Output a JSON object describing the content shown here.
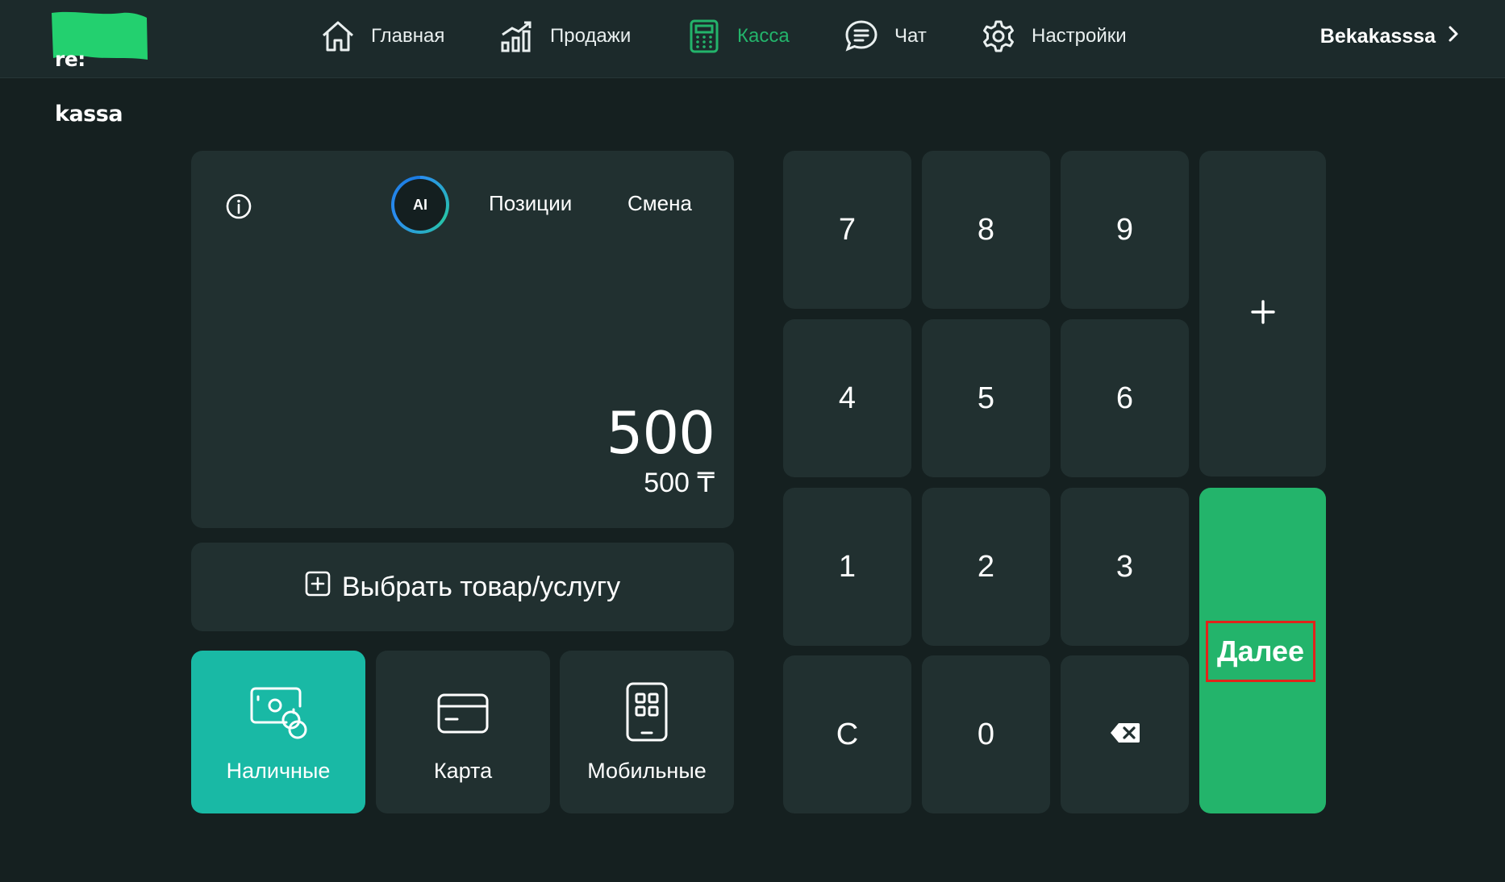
{
  "colors": {
    "background": "#152020",
    "topbar": "#1c2a2b",
    "panel": "#213030",
    "accent_green": "#23b46b",
    "active_payment": "#19b9a5",
    "highlight_border": "#e2231a"
  },
  "logo": {
    "line1": "re:",
    "line2": "kassa"
  },
  "nav": [
    {
      "label": "Главная",
      "icon": "home-icon"
    },
    {
      "label": "Продажи",
      "icon": "bar-chart-icon"
    },
    {
      "label": "Касса",
      "icon": "calculator-icon",
      "active": true
    },
    {
      "label": "Чат",
      "icon": "chat-icon"
    },
    {
      "label": "Настройки",
      "icon": "gear-icon"
    }
  ],
  "user": {
    "name": "Bekakasssa",
    "icon": "chevron-right-icon"
  },
  "panel": {
    "ai_label": "AI",
    "positions_label": "Позиции",
    "shift_label": "Смена",
    "amount_expression": "500",
    "amount_total": "500 ₸"
  },
  "choose_product": {
    "label": "Выбрать товар/услугу",
    "icon": "plus-square-icon"
  },
  "payment_methods": [
    {
      "label": "Наличные",
      "icon": "cash-icon",
      "active": true
    },
    {
      "label": "Карта",
      "icon": "card-icon",
      "active": false
    },
    {
      "label": "Мобильные",
      "icon": "mobile-qr-icon",
      "active": false
    }
  ],
  "keypad": {
    "keys": [
      [
        "7",
        "8",
        "9"
      ],
      [
        "4",
        "5",
        "6"
      ],
      [
        "1",
        "2",
        "3"
      ],
      [
        "C",
        "0",
        ""
      ]
    ],
    "backspace_icon": "backspace-icon",
    "plus_icon": "plus-icon",
    "next_label": "Далее"
  }
}
